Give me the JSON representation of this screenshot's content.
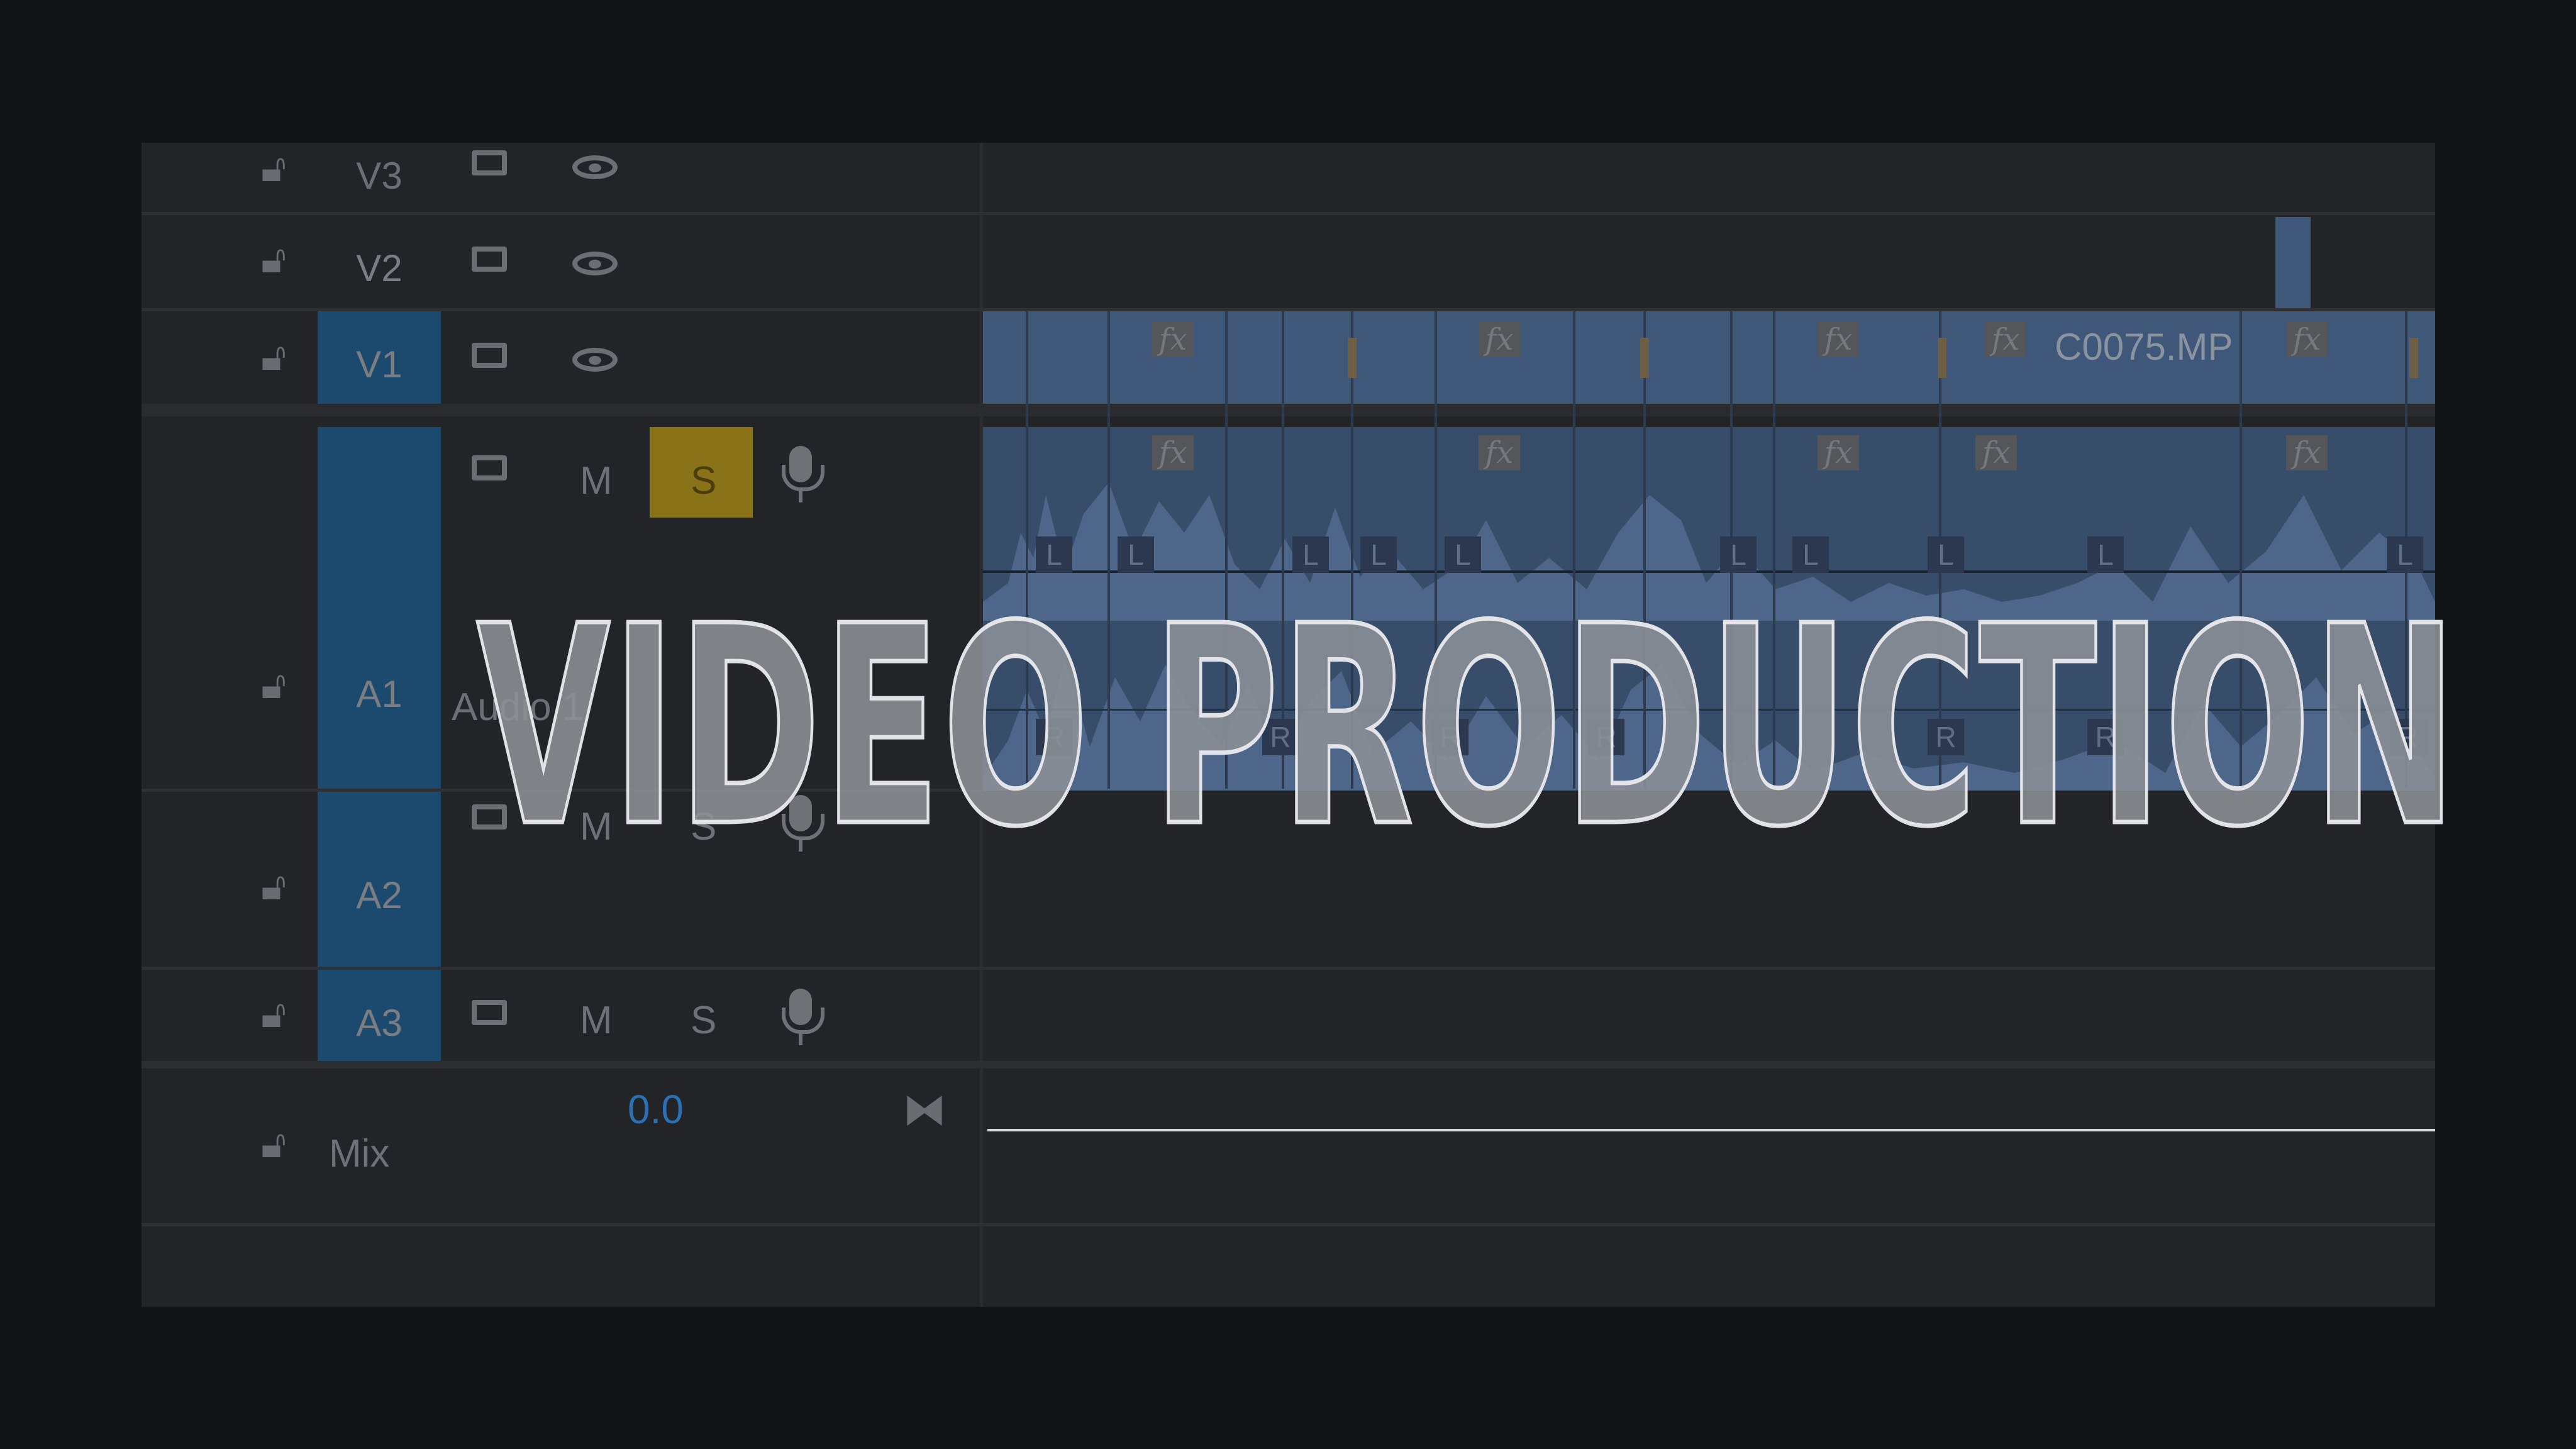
{
  "overlay": {
    "title": "VIDEO PRODUCTION"
  },
  "tracks": {
    "v3": {
      "name": "V3"
    },
    "v2": {
      "name": "V2"
    },
    "v1": {
      "name": "V1"
    },
    "a1": {
      "name": "A1",
      "label": "Audio 1",
      "mute": "M",
      "solo": "S"
    },
    "a2": {
      "name": "A2",
      "mute": "M",
      "solo": "S"
    },
    "a3": {
      "name": "A3",
      "mute": "M",
      "solo": "S"
    },
    "mix": {
      "name": "Mix",
      "value": "0.0"
    }
  },
  "clips": {
    "video_label": "C0075.MP",
    "fx_label": "fx",
    "left_channel": "L",
    "right_channel": "R"
  },
  "colors": {
    "target_active": "#1b4a6e",
    "solo_active": "#8a7218",
    "video_clip": "#3f5778",
    "audio_clip": "#384d6a",
    "mix_value": "#2b6fb4"
  }
}
